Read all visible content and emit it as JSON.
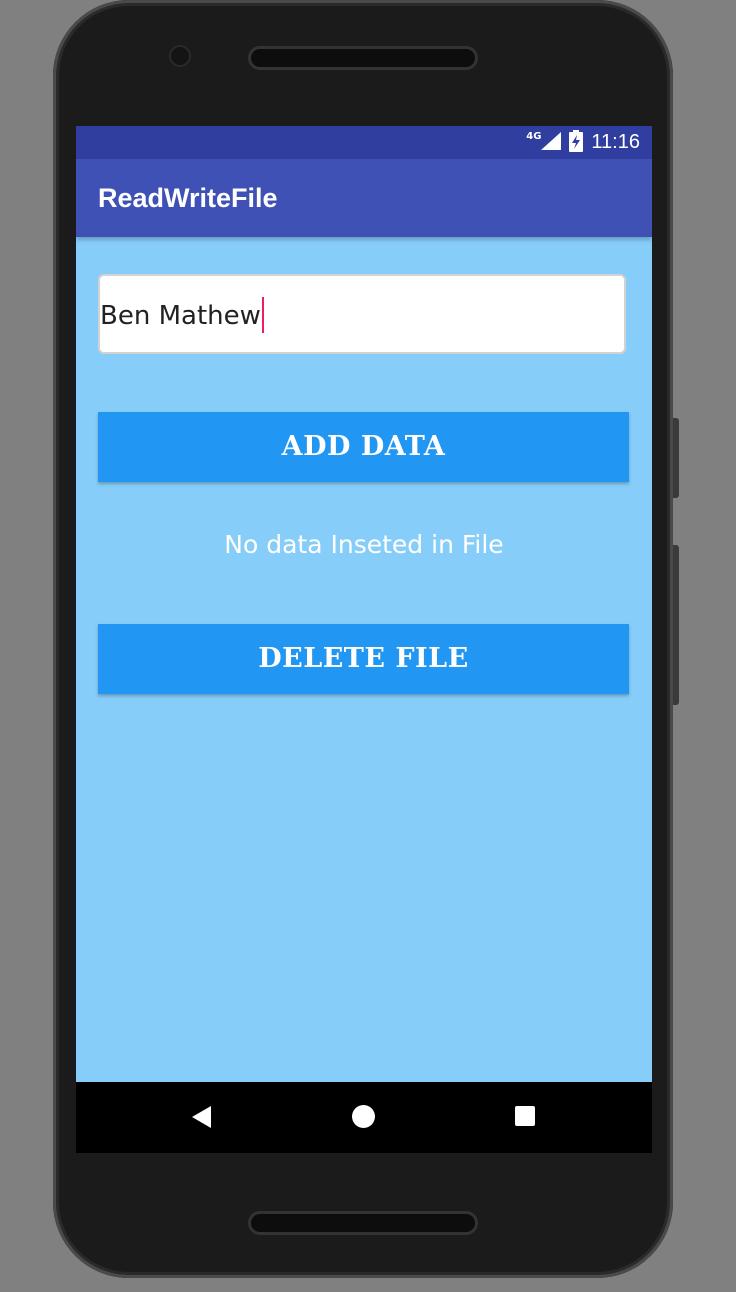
{
  "status_bar": {
    "network_label": "4G",
    "time": "11:16",
    "icons": [
      "signal-icon",
      "battery-icon"
    ]
  },
  "app_bar": {
    "title": "ReadWriteFile"
  },
  "input": {
    "value": "Ben Mathew"
  },
  "buttons": {
    "add": "ADD DATA",
    "delete": "DELETE FILE"
  },
  "message": "No data Inseted in File",
  "nav_bar": {
    "icons": [
      "back-icon",
      "home-icon",
      "recents-icon"
    ]
  },
  "colors": {
    "status_bar": "#303f9f",
    "app_bar": "#3f51b5",
    "background": "#87cdf9",
    "button": "#2196f3",
    "caret": "#e91e63"
  }
}
